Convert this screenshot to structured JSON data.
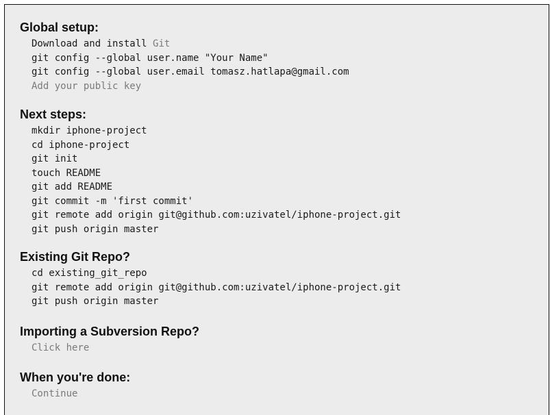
{
  "global_setup": {
    "heading": "Global setup:",
    "download_prefix": "Download and install ",
    "download_link": "Git",
    "config_name": "git config --global user.name \"Your Name\"",
    "config_email": "git config --global user.email tomasz.hatlapa@gmail.com",
    "public_key_link": "Add your public key"
  },
  "next_steps": {
    "heading": "Next steps:",
    "commands": [
      "mkdir iphone-project",
      "cd iphone-project",
      "git init",
      "touch README",
      "git add README",
      "git commit -m 'first commit'",
      "git remote add origin git@github.com:uzivatel/iphone-project.git",
      "git push origin master"
    ]
  },
  "existing_repo": {
    "heading": "Existing Git Repo?",
    "commands": [
      "cd existing_git_repo",
      "git remote add origin git@github.com:uzivatel/iphone-project.git",
      "git push origin master"
    ]
  },
  "subversion": {
    "heading": "Importing a Subversion Repo?",
    "link": "Click here"
  },
  "done": {
    "heading": "When you're done:",
    "link": "Continue"
  },
  "colors": {
    "background": "#ececec",
    "text": "#1a1a1a",
    "link": "#7a7a7a"
  }
}
